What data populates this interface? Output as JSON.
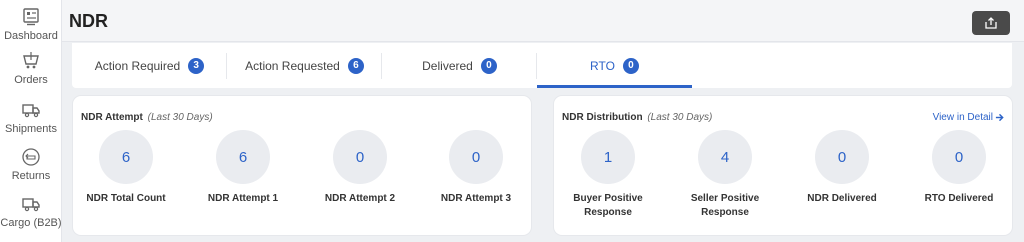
{
  "sidebar": {
    "items": [
      {
        "label": "Dashboard",
        "icon": "dashboard-icon"
      },
      {
        "label": "Orders",
        "icon": "orders-icon"
      },
      {
        "label": "Shipments",
        "icon": "truck-icon"
      },
      {
        "label": "Returns",
        "icon": "returns-icon"
      },
      {
        "label": "Cargo (B2B)",
        "icon": "cargo-truck-icon"
      }
    ]
  },
  "header": {
    "title": "NDR",
    "export_icon": "export-icon"
  },
  "tabs": [
    {
      "label": "Action Required",
      "count": "3",
      "active": false
    },
    {
      "label": "Action Requested",
      "count": "6",
      "active": false
    },
    {
      "label": "Delivered",
      "count": "0",
      "active": false
    },
    {
      "label": "RTO",
      "count": "0",
      "active": true
    }
  ],
  "attempt_card": {
    "title": "NDR Attempt",
    "subtitle": "(Last 30 Days)",
    "stats": [
      {
        "value": "6",
        "label": "NDR Total Count"
      },
      {
        "value": "6",
        "label": "NDR Attempt 1"
      },
      {
        "value": "0",
        "label": "NDR Attempt 2"
      },
      {
        "value": "0",
        "label": "NDR Attempt 3"
      }
    ]
  },
  "distribution_card": {
    "title": "NDR Distribution",
    "subtitle": "(Last 30 Days)",
    "link": "View in Detail",
    "stats": [
      {
        "value": "1",
        "label": "Buyer Positive Response"
      },
      {
        "value": "4",
        "label": "Seller Positive Response"
      },
      {
        "value": "0",
        "label": "NDR Delivered"
      },
      {
        "value": "0",
        "label": "RTO Delivered"
      }
    ]
  },
  "colors": {
    "accent": "#2d63c8",
    "circle_bg": "#eaecf0",
    "export_btn": "#4a4a4a"
  }
}
